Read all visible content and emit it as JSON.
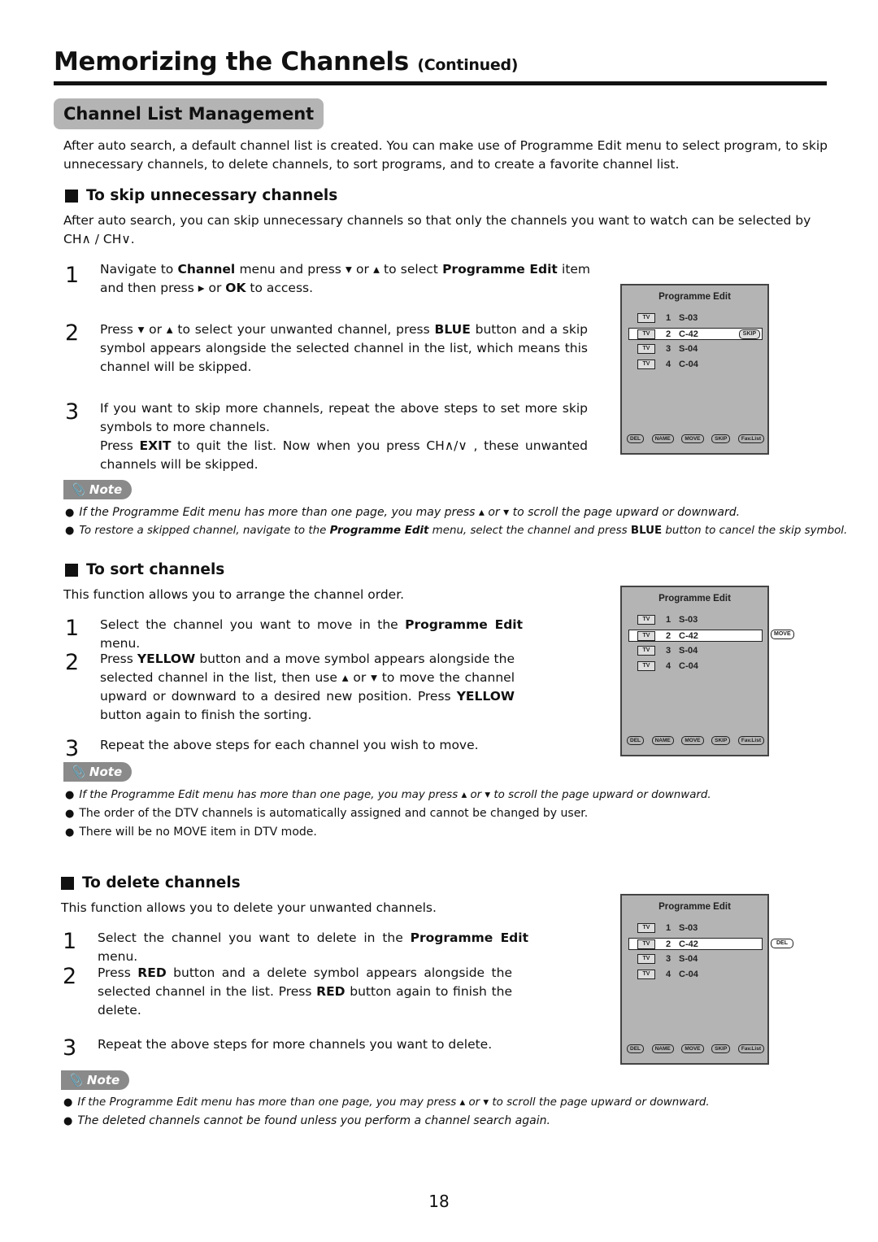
{
  "header": {
    "title": "Memorizing the Channels",
    "continued": "(Continued)"
  },
  "section": {
    "title": "Channel List Management",
    "intro": "After auto search, a default channel list is created. You can make use of Programme Edit menu to select program, to skip unnecessary channels, to delete channels, to sort programs, and to create a favorite channel list."
  },
  "skip": {
    "heading": "To skip unnecessary channels",
    "intro_a": "After auto search, you can skip unnecessary channels so that only the channels you want to watch can be selected by",
    "intro_b": "CH∧ / CH∨.",
    "steps": [
      {
        "num": "1",
        "parts": [
          "Navigate to ",
          "Channel",
          " menu and press ▾ or ▴  to select ",
          "Programme Edit",
          " item and then press ▸ or ",
          "OK",
          " to access."
        ]
      },
      {
        "num": "2",
        "parts": [
          "Press ▾ or ▴  to select your unwanted channel, press ",
          "BLUE",
          " button and a skip symbol appears alongside the selected channel in the list, which means this channel will be skipped."
        ]
      },
      {
        "num": "3",
        "parts": [
          "If you want to skip more channels, repeat the above steps to set more skip symbols to more channels.",
          "",
          ""
        ],
        "line2": [
          "Press ",
          "EXIT",
          " to quit the list. Now when you press CH∧/∨ ,  these unwanted channels will be skipped."
        ]
      }
    ],
    "note_label": "Note",
    "notes": [
      {
        "a": "If the Programme Edit menu has more than one page, you may press ▴ or ▾  to scroll the page upward or downward.",
        "b": "",
        "c": ""
      },
      {
        "a": "To restore a skipped channel, navigate to the ",
        "b": "Programme Edit",
        "c": " menu, select the channel and press ",
        "d": "BLUE",
        "e": " button to cancel the skip symbol."
      }
    ],
    "osd_flag": "SKIP"
  },
  "sort": {
    "heading": "To sort channels",
    "intro": "This function allows you to arrange the channel order.",
    "steps": [
      {
        "num": "1",
        "parts": [
          "Select the channel you want to move in the ",
          "Programme Edit",
          " menu."
        ]
      },
      {
        "num": "2",
        "parts": [
          "Press ",
          "YELLOW",
          " button and a move symbol appears alongside the selected channel in the list, then use ▴ or ▾ to move the channel upward or downward to a desired new position. Press ",
          "YELLOW",
          " button again to finish the sorting."
        ]
      },
      {
        "num": "3",
        "parts": [
          "Repeat the above steps for each channel you wish to move."
        ]
      }
    ],
    "note_label": "Note",
    "notes": [
      "If the Programme Edit menu has more than one page, you may press ▴ or ▾  to scroll the page upward or downward.",
      "The order of the DTV channels is automatically assigned and cannot be changed by user.",
      "There will be no MOVE item in DTV mode."
    ],
    "osd_flag": "MOVE"
  },
  "delete": {
    "heading": "To delete channels",
    "intro": "This function allows you to delete your unwanted channels.",
    "steps": [
      {
        "num": "1",
        "parts": [
          "Select the channel you want to delete in the ",
          "Programme Edit",
          " menu."
        ]
      },
      {
        "num": "2",
        "parts": [
          "Press ",
          "RED",
          " button and a delete symbol appears alongside the selected channel in the list. Press  ",
          "RED",
          " button again to finish the delete."
        ]
      },
      {
        "num": "3",
        "parts": [
          "Repeat the above steps for more channels you want to delete."
        ]
      }
    ],
    "note_label": "Note",
    "notes": [
      "If the Programme Edit menu has more than one page, you may press ▴ or ▾  to scroll the page upward or downward.",
      "The deleted channels cannot be found unless you perform a channel search again."
    ],
    "osd_flag": "DEL"
  },
  "osd": {
    "title": "Programme Edit",
    "channels": [
      {
        "type": "TV",
        "num": "1",
        "name": "S-03"
      },
      {
        "type": "TV",
        "num": "2",
        "name": "C-42"
      },
      {
        "type": "TV",
        "num": "3",
        "name": "S-04"
      },
      {
        "type": "TV",
        "num": "4",
        "name": "C-04"
      }
    ],
    "buttons": [
      "DEL",
      "NAME",
      "MOVE",
      "SKIP",
      "Fav.List"
    ]
  },
  "page_number": "18"
}
